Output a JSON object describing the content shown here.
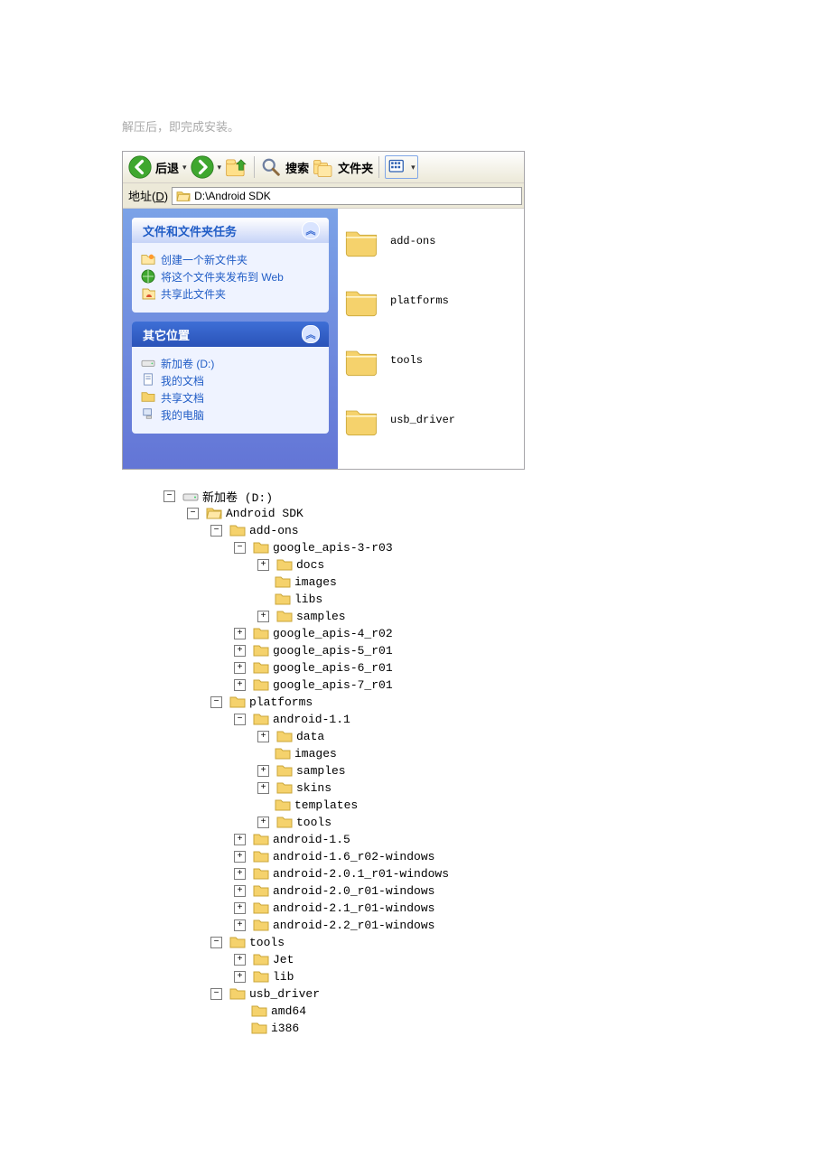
{
  "caption": "解压后，即完成安装。",
  "toolbar": {
    "back": "后退",
    "search": "搜索",
    "folders": "文件夹"
  },
  "address": {
    "label_pre": "地址(",
    "label_u": "D",
    "label_post": ")",
    "path": "D:\\Android SDK"
  },
  "sidebar": {
    "panel1": {
      "title": "文件和文件夹任务",
      "items": [
        "创建一个新文件夹",
        "将这个文件夹发布到 Web",
        "共享此文件夹"
      ]
    },
    "panel2": {
      "title": "其它位置",
      "items": [
        "新加卷 (D:)",
        "我的文档",
        "共享文档",
        "我的电脑"
      ]
    }
  },
  "files": [
    "add-ons",
    "platforms",
    "tools",
    "usb_driver"
  ],
  "tree": [
    {
      "d": 0,
      "e": "-",
      "i": "drive",
      "t": "新加卷 (D:)"
    },
    {
      "d": 1,
      "e": "-",
      "i": "fo",
      "t": "Android SDK"
    },
    {
      "d": 2,
      "e": "-",
      "i": "fc",
      "t": "add-ons"
    },
    {
      "d": 3,
      "e": "-",
      "i": "fc",
      "t": "google_apis-3-r03"
    },
    {
      "d": 4,
      "e": "+",
      "i": "fc",
      "t": "docs"
    },
    {
      "d": 4,
      "e": "",
      "i": "fc",
      "t": "images"
    },
    {
      "d": 4,
      "e": "",
      "i": "fc",
      "t": "libs"
    },
    {
      "d": 4,
      "e": "+",
      "i": "fc",
      "t": "samples"
    },
    {
      "d": 3,
      "e": "+",
      "i": "fc",
      "t": "google_apis-4_r02"
    },
    {
      "d": 3,
      "e": "+",
      "i": "fc",
      "t": "google_apis-5_r01"
    },
    {
      "d": 3,
      "e": "+",
      "i": "fc",
      "t": "google_apis-6_r01"
    },
    {
      "d": 3,
      "e": "+",
      "i": "fc",
      "t": "google_apis-7_r01"
    },
    {
      "d": 2,
      "e": "-",
      "i": "fc",
      "t": "platforms"
    },
    {
      "d": 3,
      "e": "-",
      "i": "fc",
      "t": "android-1.1"
    },
    {
      "d": 4,
      "e": "+",
      "i": "fc",
      "t": "data"
    },
    {
      "d": 4,
      "e": "",
      "i": "fc",
      "t": "images"
    },
    {
      "d": 4,
      "e": "+",
      "i": "fc",
      "t": "samples"
    },
    {
      "d": 4,
      "e": "+",
      "i": "fc",
      "t": "skins"
    },
    {
      "d": 4,
      "e": "",
      "i": "fc",
      "t": "templates"
    },
    {
      "d": 4,
      "e": "+",
      "i": "fc",
      "t": "tools"
    },
    {
      "d": 3,
      "e": "+",
      "i": "fc",
      "t": "android-1.5"
    },
    {
      "d": 3,
      "e": "+",
      "i": "fc",
      "t": "android-1.6_r02-windows"
    },
    {
      "d": 3,
      "e": "+",
      "i": "fc",
      "t": "android-2.0.1_r01-windows"
    },
    {
      "d": 3,
      "e": "+",
      "i": "fc",
      "t": "android-2.0_r01-windows"
    },
    {
      "d": 3,
      "e": "+",
      "i": "fc",
      "t": "android-2.1_r01-windows"
    },
    {
      "d": 3,
      "e": "+",
      "i": "fc",
      "t": "android-2.2_r01-windows"
    },
    {
      "d": 2,
      "e": "-",
      "i": "fc",
      "t": "tools"
    },
    {
      "d": 3,
      "e": "+",
      "i": "fc",
      "t": "Jet"
    },
    {
      "d": 3,
      "e": "+",
      "i": "fc",
      "t": "lib"
    },
    {
      "d": 2,
      "e": "-",
      "i": "fc",
      "t": "usb_driver"
    },
    {
      "d": 3,
      "e": "",
      "i": "fc",
      "t": "amd64"
    },
    {
      "d": 3,
      "e": "",
      "i": "fc",
      "t": "i386"
    }
  ]
}
